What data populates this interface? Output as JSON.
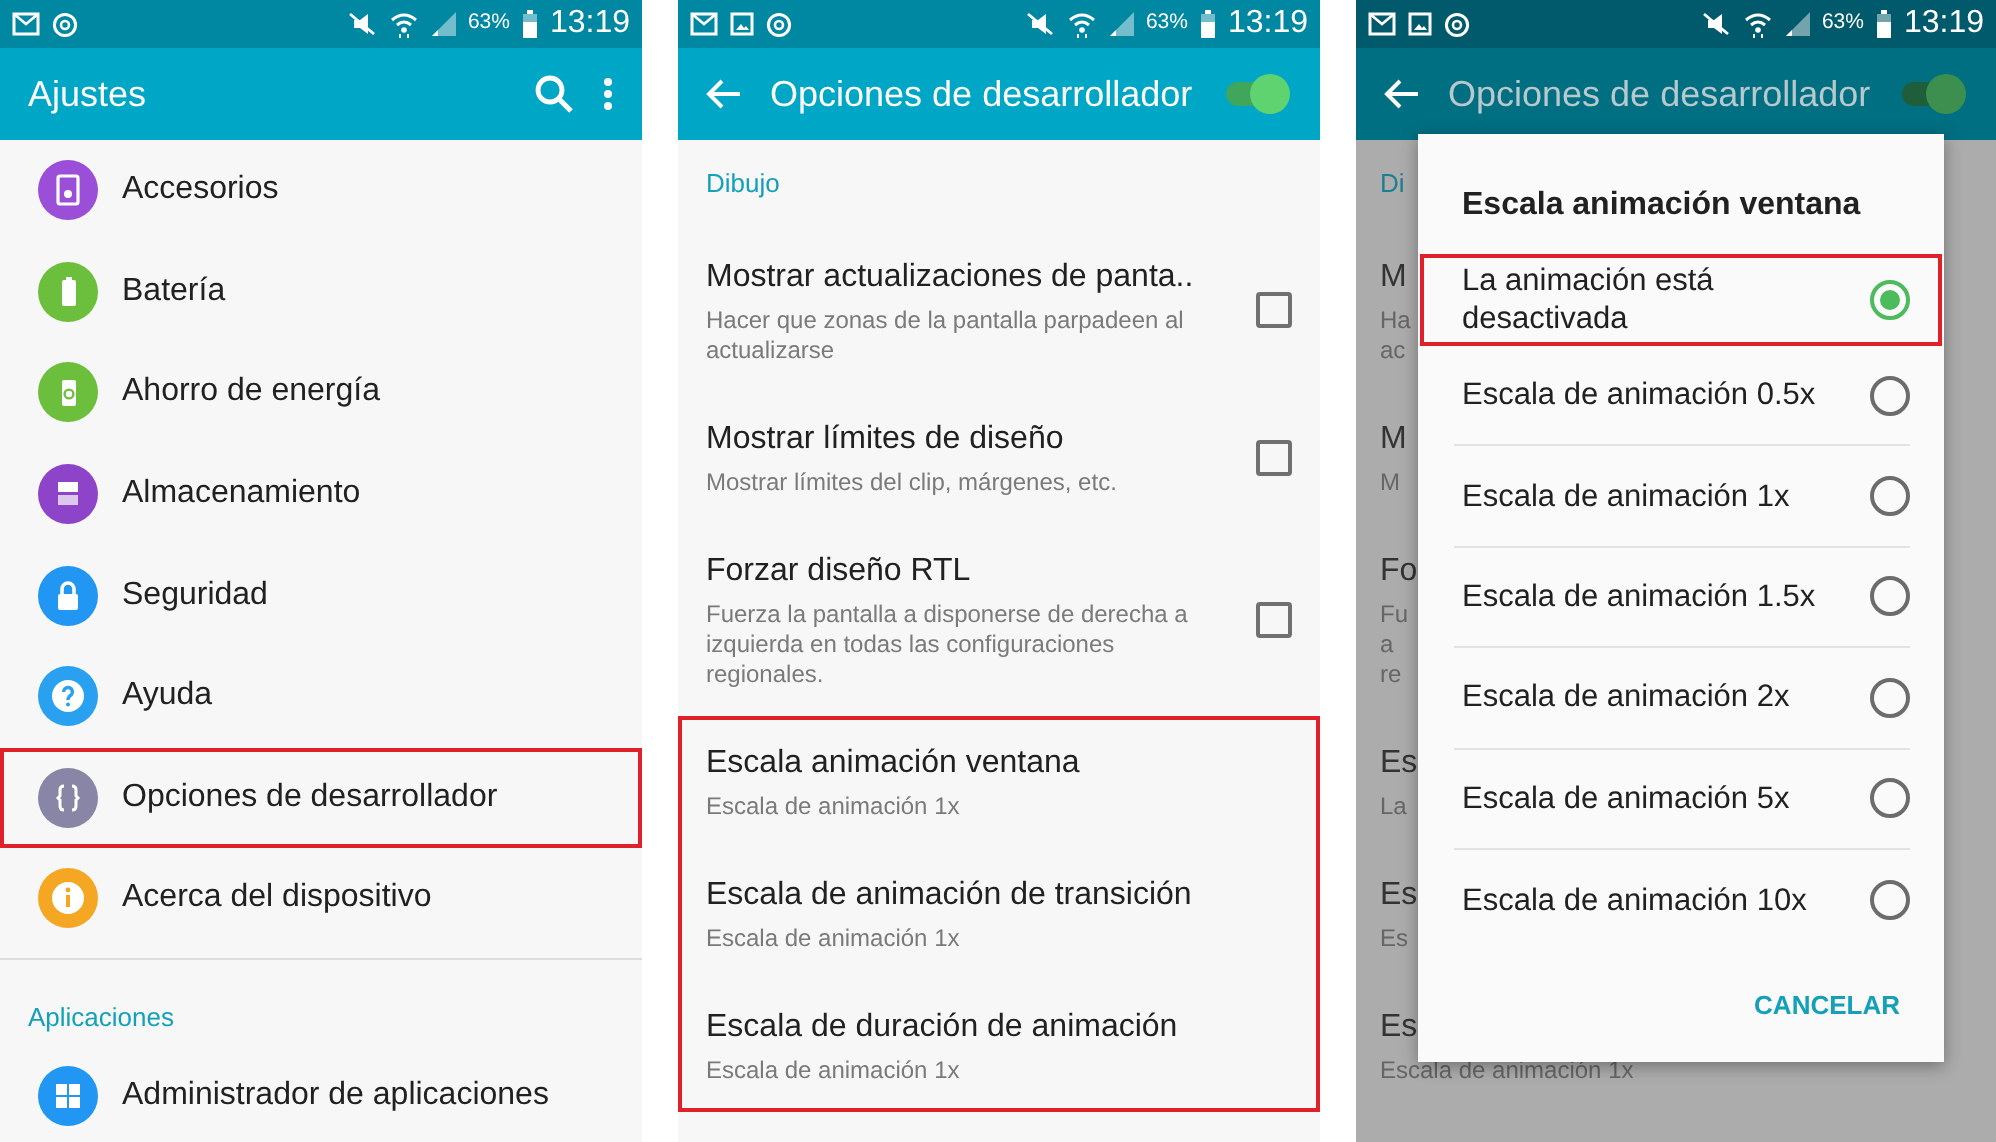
{
  "screens": [
    {
      "kind": "settings",
      "status_bar": {
        "battery": "63%",
        "time": "13:19",
        "image_notice": false
      },
      "title": "Ajustes",
      "items": [
        {
          "label": "Accesorios",
          "color": "#9b4fd8",
          "highlighted": false
        },
        {
          "label": "Batería",
          "color": "#6cbf3c",
          "highlighted": false
        },
        {
          "label": "Ahorro de energía",
          "color": "#6cbf3c",
          "highlighted": false
        },
        {
          "label": "Almacenamiento",
          "color": "#8e44c9",
          "highlighted": false
        },
        {
          "label": "Seguridad",
          "color": "#2196f3",
          "highlighted": false
        },
        {
          "label": "Ayuda",
          "color": "#2aa0f0",
          "highlighted": false
        },
        {
          "label": "Opciones de desarrollador",
          "color": "#8985a6",
          "highlighted": true
        },
        {
          "label": "Acerca del dispositivo",
          "color": "#f5a623",
          "highlighted": false
        }
      ],
      "section": "Aplicaciones",
      "section_items": [
        {
          "label": "Administrador de aplicaciones",
          "color": "#2196f3",
          "highlighted": false
        }
      ]
    },
    {
      "kind": "developer",
      "status_bar": {
        "battery": "63%",
        "time": "13:19",
        "image_notice": true
      },
      "title": "Opciones de desarrollador",
      "switch_on": true,
      "section": "Dibujo",
      "options": [
        {
          "title": "Mostrar actualizaciones de panta..",
          "subtitle": "Hacer que zonas de la pantalla parpadeen al actualizarse",
          "kind": "checkbox",
          "checked": false,
          "highlighted": false
        },
        {
          "title": "Mostrar límites de diseño",
          "subtitle": "Mostrar límites del clip, márgenes, etc.",
          "kind": "checkbox",
          "checked": false,
          "highlighted": false
        },
        {
          "title": "Forzar diseño RTL",
          "subtitle": "Fuerza la pantalla a disponerse de derecha a izquierda en todas las configuraciones regionales.",
          "kind": "checkbox",
          "checked": false,
          "highlighted": false
        },
        {
          "title": "Escala animación ventana",
          "subtitle": "Escala de animación 1x",
          "kind": "plain",
          "highlighted": true
        },
        {
          "title": "Escala de animación de transición",
          "subtitle": "Escala de animación 1x",
          "kind": "plain",
          "highlighted": true
        },
        {
          "title": "Escala de duración de animación",
          "subtitle": "Escala de animación 1x",
          "kind": "plain",
          "highlighted": true
        }
      ]
    },
    {
      "kind": "dialog",
      "status_bar": {
        "battery": "63%",
        "time": "13:19",
        "image_notice": true
      },
      "title": "Opciones de desarrollador",
      "switch_on": true,
      "section": "Di",
      "background": [
        {
          "title": "M",
          "lines": [
            "Ha",
            "ac"
          ]
        },
        {
          "title": "M",
          "lines": [
            "M"
          ]
        },
        {
          "title": "Fo",
          "lines": [
            "Fu",
            "a",
            "re"
          ]
        },
        {
          "title": "Es",
          "lines": [
            "La"
          ]
        },
        {
          "title": "Es",
          "lines": [
            "Es"
          ]
        },
        {
          "title": "Es",
          "lines": [
            "Escala de animación 1x"
          ]
        }
      ],
      "dialog": {
        "title": "Escala animación ventana",
        "cancel": "CANCELAR",
        "choices": [
          {
            "label": "La animación está desactivada",
            "selected": true,
            "highlighted": true
          },
          {
            "label": "Escala de animación 0.5x",
            "selected": false,
            "highlighted": false
          },
          {
            "label": "Escala de animación 1x",
            "selected": false,
            "highlighted": false
          },
          {
            "label": "Escala de animación 1.5x",
            "selected": false,
            "highlighted": false
          },
          {
            "label": "Escala de animación 2x",
            "selected": false,
            "highlighted": false
          },
          {
            "label": "Escala de animación 5x",
            "selected": false,
            "highlighted": false
          },
          {
            "label": "Escala de animación 10x",
            "selected": false,
            "highlighted": false
          }
        ]
      }
    }
  ]
}
